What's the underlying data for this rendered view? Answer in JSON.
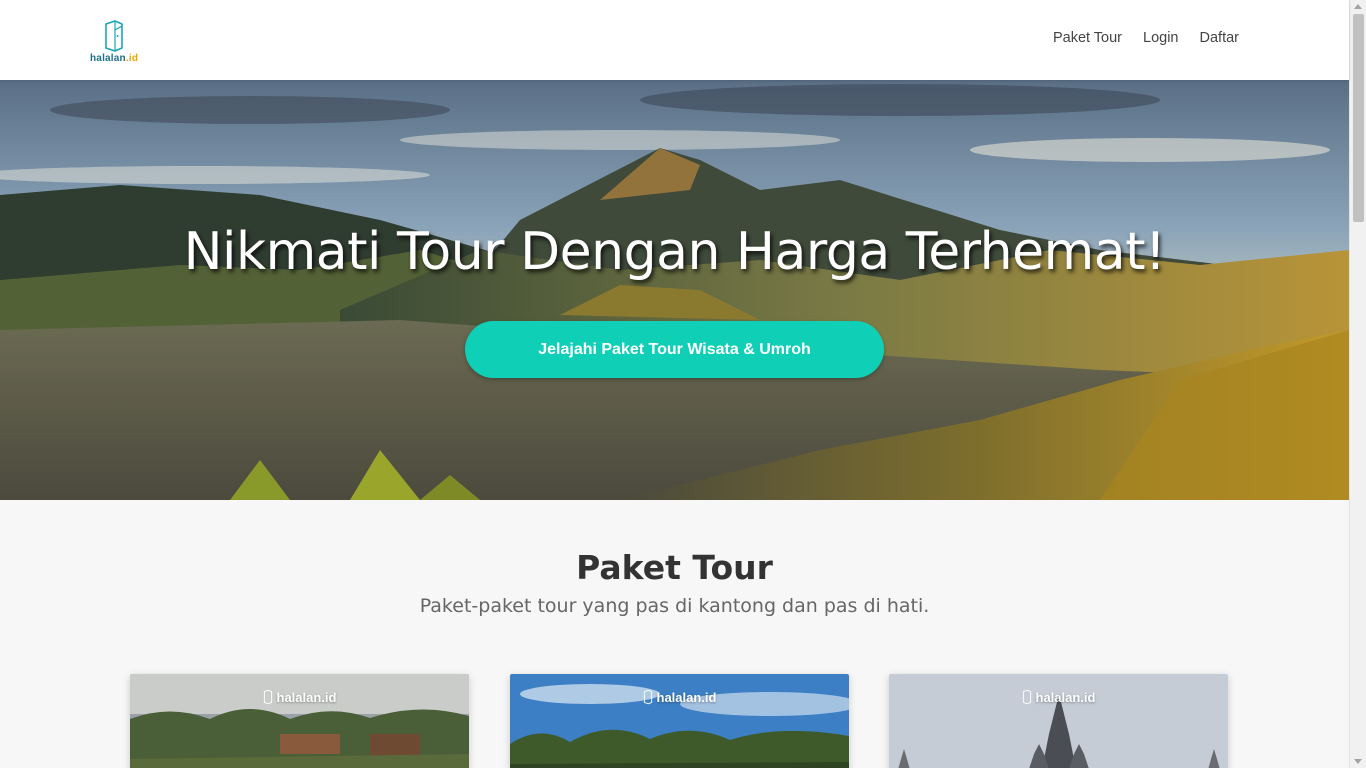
{
  "brand": {
    "logo_name": "halalan",
    "logo_suffix": ".id",
    "logo_icon": "halalan-door-icon"
  },
  "nav": {
    "items": [
      "Paket Tour",
      "Login",
      "Daftar"
    ]
  },
  "hero": {
    "title": "Nikmati Tour Dengan Harga Terhemat!",
    "cta_label": "Jelajahi Paket Tour Wisata & Umroh"
  },
  "section": {
    "title": "Paket Tour",
    "subtitle": "Paket-paket tour yang pas di kantong dan pas di hati."
  },
  "cards": [
    {
      "watermark": "halalan.id"
    },
    {
      "watermark": "halalan.id"
    },
    {
      "watermark": "halalan.id"
    }
  ],
  "colors": {
    "accent": "#0fcfb7",
    "brand": "#1f6f8b",
    "brand_suffix": "#f0a500"
  }
}
